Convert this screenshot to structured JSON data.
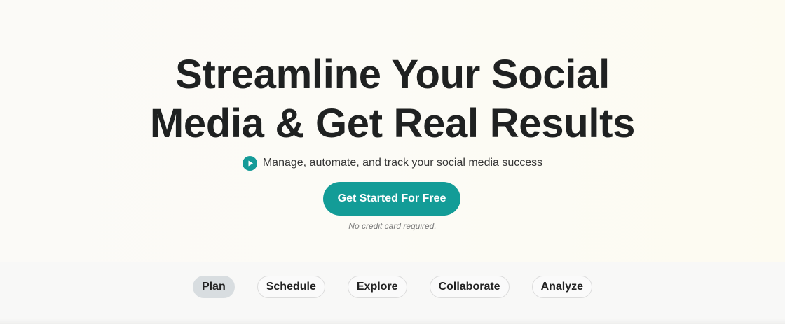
{
  "hero": {
    "headline_line1": "Streamline Your Social",
    "headline_line2": "Media & Get Real Results",
    "tagline": "Manage, automate, and track your social media success",
    "tagline_icon": "play-circle-icon",
    "cta_label": "Get Started For Free",
    "note": "No credit card required."
  },
  "tabs": [
    {
      "label": "Plan",
      "active": true
    },
    {
      "label": "Schedule",
      "active": false
    },
    {
      "label": "Explore",
      "active": false
    },
    {
      "label": "Collaborate",
      "active": false
    },
    {
      "label": "Analyze",
      "active": false
    }
  ],
  "colors": {
    "accent": "#139c97",
    "text": "#1f2121",
    "active_tab_bg": "#d8dde0"
  }
}
